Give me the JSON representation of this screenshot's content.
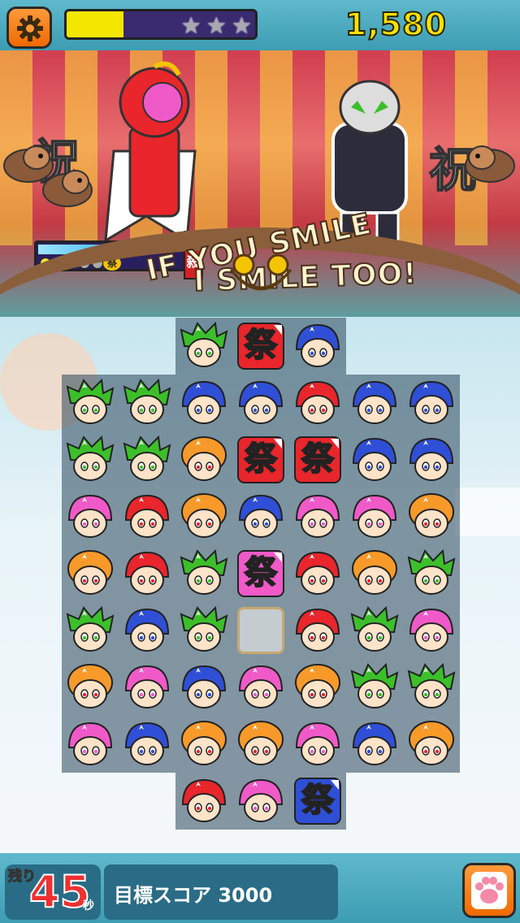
{
  "hud": {
    "score": "1,580",
    "progress_fraction": 0.3,
    "stars_total": 3,
    "stars_earned": 0,
    "settings_icon": "gear-icon"
  },
  "stage": {
    "banner_left": "IF YOU SMILE",
    "banner_right": "I SMILE TOO!",
    "kanji_left": "祝",
    "kanji_right": "祝",
    "special_label": "必殺",
    "special_chip": "祭",
    "special_gauge_fraction": 0.58,
    "special_dots_on": 3,
    "special_dots_total": 5
  },
  "board": {
    "rows": [
      [
        "",
        "",
        "green",
        "red-matsuri",
        "blue",
        "",
        ""
      ],
      [
        "green",
        "green",
        "blue",
        "blue",
        "red",
        "blue",
        "blue"
      ],
      [
        "green",
        "green",
        "orange",
        "red-matsuri",
        "red-matsuri",
        "blue",
        "blue"
      ],
      [
        "pink",
        "red",
        "orange",
        "blue",
        "pink",
        "pink",
        "orange"
      ],
      [
        "orange",
        "red",
        "green",
        "pink-matsuri",
        "red",
        "orange",
        "green"
      ],
      [
        "green",
        "blue",
        "green",
        "empty",
        "red",
        "green",
        "pink"
      ],
      [
        "orange",
        "pink",
        "blue",
        "pink",
        "orange",
        "green",
        "green"
      ],
      [
        "pink",
        "blue",
        "orange",
        "orange",
        "pink",
        "blue",
        "orange"
      ],
      [
        "",
        "",
        "red",
        "pink",
        "blue-matsuri",
        "",
        ""
      ]
    ],
    "matsuri_char": "祭",
    "colors": {
      "red": "#e8262c",
      "blue": "#2f4fd6",
      "green": "#3cbf2a",
      "pink": "#f05ac8",
      "orange": "#f79a2a"
    }
  },
  "footer": {
    "timer_prefix": "残り",
    "timer_value": "45",
    "timer_unit": "秒",
    "target_label": "目標スコア 3000",
    "paw_icon": "paw-icon"
  }
}
